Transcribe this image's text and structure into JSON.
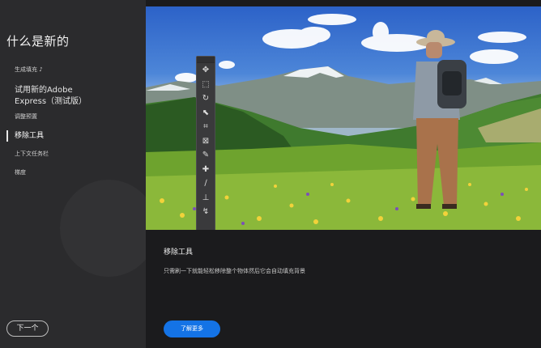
{
  "sidebar": {
    "title": "什么是新的",
    "items": [
      {
        "label": "生成填充 ♪"
      },
      {
        "label": "试用新的Adobe Express（测试版）"
      },
      {
        "label": "调整预置"
      },
      {
        "label": "移除工具"
      },
      {
        "label": "上下文任务栏"
      },
      {
        "label": "梯度"
      }
    ],
    "next_label": "下一个"
  },
  "main": {
    "feature_title": "移除工具",
    "feature_description": "只需刷一下就能轻松移除整个物体然后它会自动填充背景",
    "learn_more_label": "了解更多",
    "accent_color": "#1473e6"
  },
  "toolbar": {
    "tools": [
      {
        "name": "move-tool-icon",
        "glyph": "✥"
      },
      {
        "name": "marquee-tool-icon",
        "glyph": "⬚"
      },
      {
        "name": "lasso-tool-icon",
        "glyph": "↻"
      },
      {
        "name": "object-select-tool-icon",
        "glyph": "⬉"
      },
      {
        "name": "crop-tool-icon",
        "glyph": "⌗"
      },
      {
        "name": "frame-tool-icon",
        "glyph": "⊠"
      },
      {
        "name": "eyedropper-tool-icon",
        "glyph": "✎"
      },
      {
        "name": "healing-brush-icon",
        "glyph": "✚"
      },
      {
        "name": "brush-tool-icon",
        "glyph": "∕"
      },
      {
        "name": "stamp-tool-icon",
        "glyph": "⊥"
      },
      {
        "name": "history-brush-icon",
        "glyph": "↯"
      }
    ]
  }
}
